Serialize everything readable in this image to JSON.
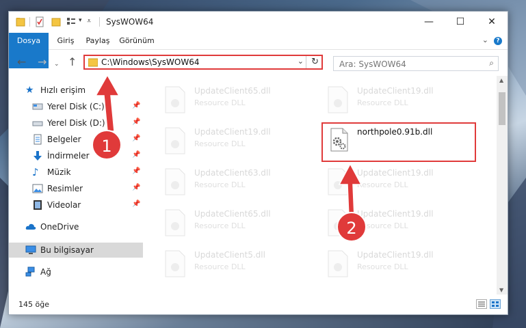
{
  "window": {
    "title": "SysWOW64",
    "controls": [
      "minimize-icon",
      "maximize-icon",
      "close-icon"
    ]
  },
  "ribbon": {
    "tabs": [
      {
        "label": "Dosya"
      },
      {
        "label": "Giriş"
      },
      {
        "label": "Paylaş"
      },
      {
        "label": "Görünüm"
      }
    ],
    "help_label": "?"
  },
  "navbar": {
    "address": "C:\\Windows\\SysWOW64",
    "search_placeholder": "Ara: SysWOW64"
  },
  "sidebar": {
    "items": [
      {
        "label": "Hızlı erişim",
        "icon": "star-icon"
      },
      {
        "label": "Yerel Disk (C:)",
        "icon": "drive-icon",
        "pinned": true
      },
      {
        "label": "Yerel Disk (D:)",
        "icon": "drive-icon",
        "pinned": true
      },
      {
        "label": "Belgeler",
        "icon": "documents-icon",
        "pinned": true
      },
      {
        "label": "İndirmeler",
        "icon": "download-icon",
        "pinned": true
      },
      {
        "label": "Müzik",
        "icon": "music-icon",
        "pinned": true
      },
      {
        "label": "Resimler",
        "icon": "pictures-icon",
        "pinned": true
      },
      {
        "label": "Videolar",
        "icon": "videos-icon",
        "pinned": true
      },
      {
        "label": "OneDrive",
        "icon": "cloud-icon"
      },
      {
        "label": "Bu bilgisayar",
        "icon": "computer-icon",
        "selected": true
      },
      {
        "label": "Ağ",
        "icon": "network-icon"
      }
    ]
  },
  "files": [
    {
      "name": "UpdateClient65.dll",
      "desc": "Resource DLL"
    },
    {
      "name": "UpdateClient19.dll",
      "desc": "Resource DLL"
    },
    {
      "name": "UpdateClient19.dll",
      "desc": "Resource DLL"
    },
    {
      "name": "northpole0.91b.dll",
      "desc": ""
    },
    {
      "name": "UpdateClient63.dll",
      "desc": "Resource DLL"
    },
    {
      "name": "UpdateClient19.dll",
      "desc": "Resource DLL"
    },
    {
      "name": "UpdateClient65.dll",
      "desc": "Resource DLL"
    },
    {
      "name": "UpdateClient19.dll",
      "desc": "Resource DLL"
    },
    {
      "name": "UpdateClient5.dll",
      "desc": "Resource DLL"
    },
    {
      "name": "UpdateClient19.dll",
      "desc": "Resource DLL"
    }
  ],
  "status": {
    "count": "145 öğe"
  },
  "annotations": {
    "step1": "1",
    "step2": "2",
    "color": "#e03a3a"
  }
}
